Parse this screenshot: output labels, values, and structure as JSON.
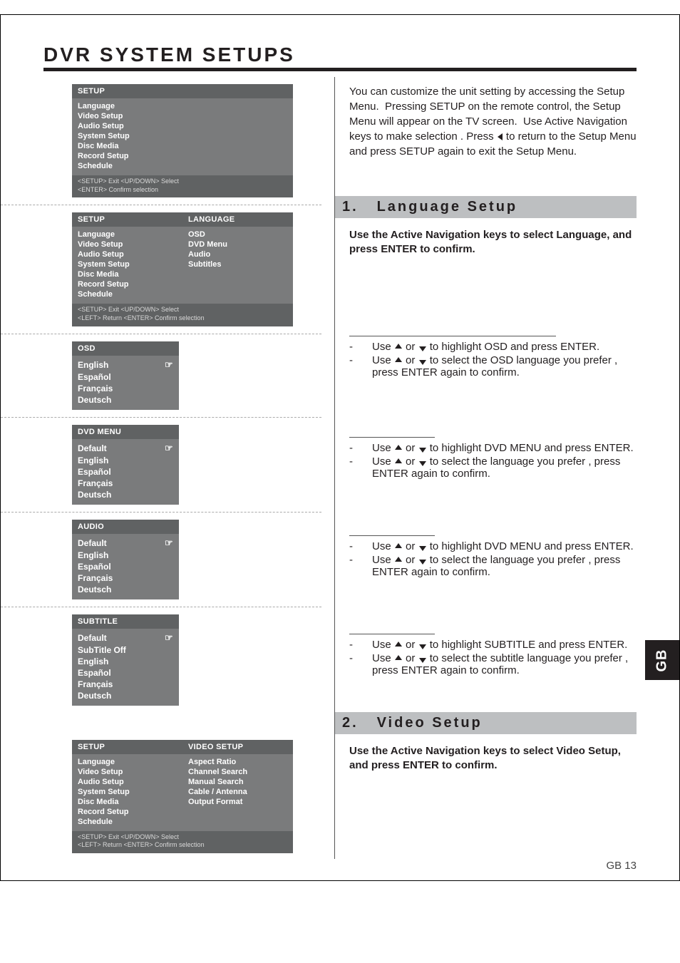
{
  "title": "DVR SYSTEM SETUPS",
  "side_tab": "GB",
  "page_number": "GB 13",
  "intro": "You can customize the unit setting by accessing the Setup Menu.  Pressing SETUP on the remote control, the Setup Menu will appear on the TV screen.  Use Active Navigation keys to make selection . Press ◂ to return to the Setup Menu and press SETUP again to exit the Setup Menu.",
  "setup_items": [
    "Language",
    "Video Setup",
    "Audio Setup",
    "System Setup",
    "Disc Media",
    "Record Setup",
    "Schedule"
  ],
  "footer_keys1": "<SETUP> Exit   <UP/DOWN> Select",
  "footer_keys1b": "<ENTER> Confirm selection",
  "footer_keys2": "<SETUP> Exit   <UP/DOWN> Select",
  "footer_keys2b": "<LEFT> Return  <ENTER> Confirm selection",
  "language_submenu_header": "LANGUAGE",
  "language_submenu_items": [
    "OSD",
    "DVD Menu",
    "Audio",
    "Subtitles"
  ],
  "osd_header": "OSD",
  "osd_items": [
    "English",
    "Español",
    "Français",
    "Deutsch"
  ],
  "dvdmenu_header": "DVD MENU",
  "dvdmenu_items": [
    "Default",
    "English",
    "Español",
    "Français",
    "Deutsch"
  ],
  "audio_header": "AUDIO",
  "audio_items": [
    "Default",
    "English",
    "Español",
    "Français",
    "Deutsch"
  ],
  "subtitle_header": "SUBTITLE",
  "subtitle_items": [
    "Default",
    "SubTitle Off",
    "English",
    "Español",
    "Français",
    "Deutsch"
  ],
  "video_submenu_header": "VIDEO SETUP",
  "video_submenu_items": [
    "Aspect Ratio",
    "Channel Search",
    "Manual Search",
    "Cable / Antenna",
    "Output Format"
  ],
  "sec1_num": "1.",
  "sec1_title": "Language Setup",
  "sec1_instr": "Use the Active Navigation keys to select Language, and press ENTER to confirm.",
  "sec2_num": "2.",
  "sec2_title": "Video Setup",
  "sec2_instr": "Use the Active Navigation keys to select Video Setup, and press ENTER to confirm.",
  "step_osd_a": "Use ▴ or ▾ to highlight OSD and press ENTER.",
  "step_osd_b": "Use ▴ or ▾ to select the OSD language you prefer , press ENTER again to confirm.",
  "step_dvd_a": "Use ▴ or ▾ to highlight DVD MENU and press ENTER.",
  "step_dvd_b": "Use ▴ or ▾ to select the language you prefer , press ENTER again to confirm.",
  "step_audio_a": "Use ▴ or ▾ to highlight DVD MENU and press ENTER.",
  "step_audio_b": "Use ▴ or ▾ to select the language you prefer , press ENTER again to confirm.",
  "step_sub_a": "Use ▴ or ▾ to highlight SUBTITLE and press ENTER.",
  "step_sub_b": "Use ▴ or ▾ to select the subtitle language you prefer , press ENTER again to confirm.",
  "setup_header": "SETUP"
}
